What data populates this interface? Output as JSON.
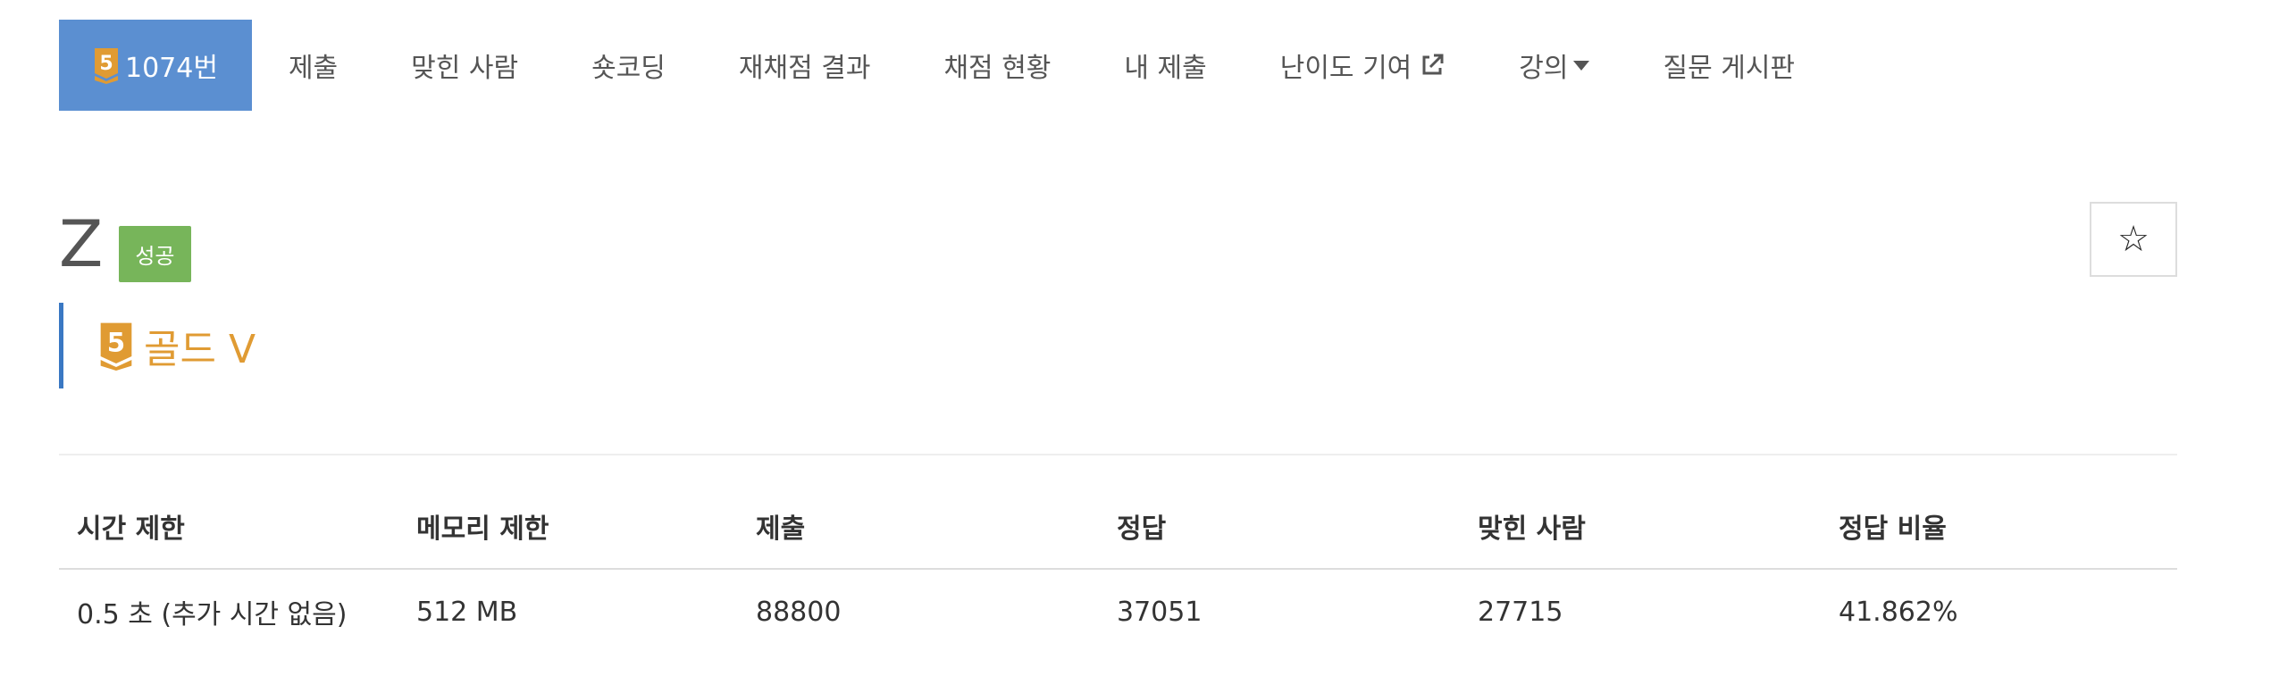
{
  "nav": {
    "problem_number": "1074번",
    "tier_number": "5",
    "items": [
      "제출",
      "맞힌 사람",
      "숏코딩",
      "재채점 결과",
      "채점 현황",
      "내 제출",
      "난이도 기여",
      "강의",
      "질문 게시판"
    ]
  },
  "problem": {
    "title": "Z",
    "status_badge": "성공",
    "tier_label": "골드 V",
    "tier_number": "5",
    "star_symbol": "☆"
  },
  "table": {
    "headers": [
      "시간 제한",
      "메모리 제한",
      "제출",
      "정답",
      "맞힌 사람",
      "정답 비율"
    ],
    "values": [
      "0.5 초 (추가 시간 없음)",
      "512 MB",
      "88800",
      "37051",
      "27715",
      "41.862%"
    ]
  },
  "colors": {
    "nav_active": "#5b8fd1",
    "gold": "#e09b33",
    "success": "#77b55a",
    "tier_border": "#3a78c3"
  },
  "icons": {
    "tier": "gold-tier-icon",
    "external_link": "external-link-icon",
    "caret": "caret-down-icon",
    "star": "star-outline-icon"
  }
}
